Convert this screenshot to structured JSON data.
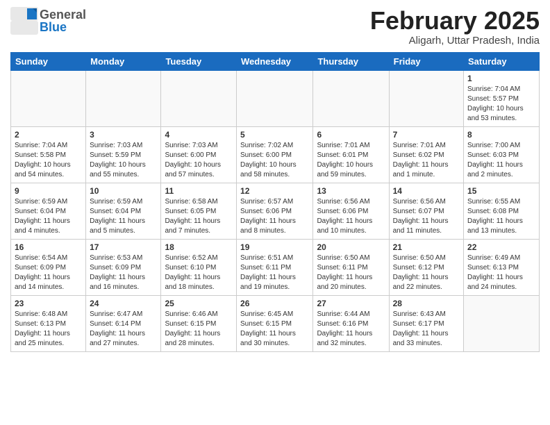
{
  "header": {
    "logo_general": "General",
    "logo_blue": "Blue",
    "month_title": "February 2025",
    "location": "Aligarh, Uttar Pradesh, India"
  },
  "weekdays": [
    "Sunday",
    "Monday",
    "Tuesday",
    "Wednesday",
    "Thursday",
    "Friday",
    "Saturday"
  ],
  "weeks": [
    [
      {
        "day": "",
        "info": ""
      },
      {
        "day": "",
        "info": ""
      },
      {
        "day": "",
        "info": ""
      },
      {
        "day": "",
        "info": ""
      },
      {
        "day": "",
        "info": ""
      },
      {
        "day": "",
        "info": ""
      },
      {
        "day": "1",
        "info": "Sunrise: 7:04 AM\nSunset: 5:57 PM\nDaylight: 10 hours\nand 53 minutes."
      }
    ],
    [
      {
        "day": "2",
        "info": "Sunrise: 7:04 AM\nSunset: 5:58 PM\nDaylight: 10 hours\nand 54 minutes."
      },
      {
        "day": "3",
        "info": "Sunrise: 7:03 AM\nSunset: 5:59 PM\nDaylight: 10 hours\nand 55 minutes."
      },
      {
        "day": "4",
        "info": "Sunrise: 7:03 AM\nSunset: 6:00 PM\nDaylight: 10 hours\nand 57 minutes."
      },
      {
        "day": "5",
        "info": "Sunrise: 7:02 AM\nSunset: 6:00 PM\nDaylight: 10 hours\nand 58 minutes."
      },
      {
        "day": "6",
        "info": "Sunrise: 7:01 AM\nSunset: 6:01 PM\nDaylight: 10 hours\nand 59 minutes."
      },
      {
        "day": "7",
        "info": "Sunrise: 7:01 AM\nSunset: 6:02 PM\nDaylight: 11 hours\nand 1 minute."
      },
      {
        "day": "8",
        "info": "Sunrise: 7:00 AM\nSunset: 6:03 PM\nDaylight: 11 hours\nand 2 minutes."
      }
    ],
    [
      {
        "day": "9",
        "info": "Sunrise: 6:59 AM\nSunset: 6:04 PM\nDaylight: 11 hours\nand 4 minutes."
      },
      {
        "day": "10",
        "info": "Sunrise: 6:59 AM\nSunset: 6:04 PM\nDaylight: 11 hours\nand 5 minutes."
      },
      {
        "day": "11",
        "info": "Sunrise: 6:58 AM\nSunset: 6:05 PM\nDaylight: 11 hours\nand 7 minutes."
      },
      {
        "day": "12",
        "info": "Sunrise: 6:57 AM\nSunset: 6:06 PM\nDaylight: 11 hours\nand 8 minutes."
      },
      {
        "day": "13",
        "info": "Sunrise: 6:56 AM\nSunset: 6:06 PM\nDaylight: 11 hours\nand 10 minutes."
      },
      {
        "day": "14",
        "info": "Sunrise: 6:56 AM\nSunset: 6:07 PM\nDaylight: 11 hours\nand 11 minutes."
      },
      {
        "day": "15",
        "info": "Sunrise: 6:55 AM\nSunset: 6:08 PM\nDaylight: 11 hours\nand 13 minutes."
      }
    ],
    [
      {
        "day": "16",
        "info": "Sunrise: 6:54 AM\nSunset: 6:09 PM\nDaylight: 11 hours\nand 14 minutes."
      },
      {
        "day": "17",
        "info": "Sunrise: 6:53 AM\nSunset: 6:09 PM\nDaylight: 11 hours\nand 16 minutes."
      },
      {
        "day": "18",
        "info": "Sunrise: 6:52 AM\nSunset: 6:10 PM\nDaylight: 11 hours\nand 18 minutes."
      },
      {
        "day": "19",
        "info": "Sunrise: 6:51 AM\nSunset: 6:11 PM\nDaylight: 11 hours\nand 19 minutes."
      },
      {
        "day": "20",
        "info": "Sunrise: 6:50 AM\nSunset: 6:11 PM\nDaylight: 11 hours\nand 20 minutes."
      },
      {
        "day": "21",
        "info": "Sunrise: 6:50 AM\nSunset: 6:12 PM\nDaylight: 11 hours\nand 22 minutes."
      },
      {
        "day": "22",
        "info": "Sunrise: 6:49 AM\nSunset: 6:13 PM\nDaylight: 11 hours\nand 24 minutes."
      }
    ],
    [
      {
        "day": "23",
        "info": "Sunrise: 6:48 AM\nSunset: 6:13 PM\nDaylight: 11 hours\nand 25 minutes."
      },
      {
        "day": "24",
        "info": "Sunrise: 6:47 AM\nSunset: 6:14 PM\nDaylight: 11 hours\nand 27 minutes."
      },
      {
        "day": "25",
        "info": "Sunrise: 6:46 AM\nSunset: 6:15 PM\nDaylight: 11 hours\nand 28 minutes."
      },
      {
        "day": "26",
        "info": "Sunrise: 6:45 AM\nSunset: 6:15 PM\nDaylight: 11 hours\nand 30 minutes."
      },
      {
        "day": "27",
        "info": "Sunrise: 6:44 AM\nSunset: 6:16 PM\nDaylight: 11 hours\nand 32 minutes."
      },
      {
        "day": "28",
        "info": "Sunrise: 6:43 AM\nSunset: 6:17 PM\nDaylight: 11 hours\nand 33 minutes."
      },
      {
        "day": "",
        "info": ""
      }
    ]
  ]
}
